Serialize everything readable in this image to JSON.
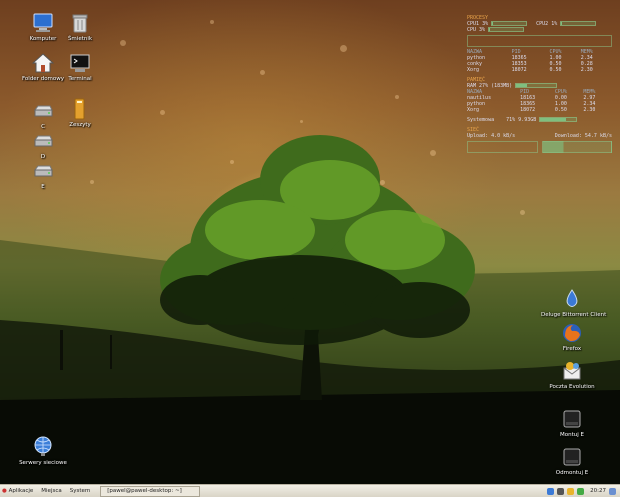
{
  "desktop": {
    "left_icons": [
      {
        "label": "Komputer",
        "icon": "computer-icon"
      },
      {
        "label": "Śmietnik",
        "icon": "trash-icon"
      },
      {
        "label": "Folder domowy",
        "icon": "home-icon"
      },
      {
        "label": "Terminal",
        "icon": "terminal-icon"
      },
      {
        "label": "C",
        "icon": "drive-icon"
      },
      {
        "label": "Zeszyty",
        "icon": "folder-icon"
      },
      {
        "label": "D",
        "icon": "drive-icon"
      },
      {
        "label": "E",
        "icon": "drive-icon"
      },
      {
        "label": "Serwery sieciowe",
        "icon": "network-globe-icon"
      }
    ],
    "right_icons": [
      {
        "label": "Deluge Bittorrent Client",
        "icon": "deluge-icon"
      },
      {
        "label": "Firefox",
        "icon": "firefox-icon"
      },
      {
        "label": "Poczta Evolution",
        "icon": "evolution-mail-icon"
      },
      {
        "label": "Montuj E",
        "icon": "drive-icon"
      },
      {
        "label": "Odmontuj E",
        "icon": "drive-icon"
      }
    ]
  },
  "conky": {
    "procesy_title": "PROCESY",
    "cpu1_label": "CPU1",
    "cpu1_value": "3%",
    "cpu1": 0.03,
    "cpu2_label": "CPU2",
    "cpu2_value": "1%",
    "cpu2": 0.01,
    "cpu_label": "CPU",
    "cpu_value": "3%",
    "cpu": 0.03,
    "proc_headers": [
      "NAZWA",
      "PID",
      "CPU%",
      "MEM%"
    ],
    "proc_rows": [
      [
        "python",
        "18365",
        "1.00",
        "2.34"
      ],
      [
        "conky",
        "18353",
        "0.50",
        "0.28"
      ],
      [
        "Xorg",
        "18072",
        "0.50",
        "2.30"
      ]
    ],
    "pamiec_title": "PAMIĘĆ",
    "ram_label": "RAM",
    "ram_value": "27% (183MB)",
    "ram": 0.27,
    "mem_headers": [
      "NAZWA",
      "PID",
      "CPU%",
      "MEM%"
    ],
    "mem_rows": [
      [
        "nautilus",
        "18163",
        "0.00",
        "2.97"
      ],
      [
        "python",
        "18365",
        "1.00",
        "2.34"
      ],
      [
        "Xorg",
        "18072",
        "0.50",
        "2.30"
      ]
    ],
    "system_label": "Systemowa",
    "system_value": "71% 9.93GB",
    "system": 0.71,
    "siec_title": "SIEĆ",
    "upload_label": "Upload: 4.0  kB/s",
    "download_label": "Download: 54.7  kB/s"
  },
  "panel": {
    "menu": [
      "Aplikacje",
      "Miejsca",
      "System"
    ],
    "task": "[pawel@pawel-desktop: ~]",
    "clock": "20:27"
  }
}
